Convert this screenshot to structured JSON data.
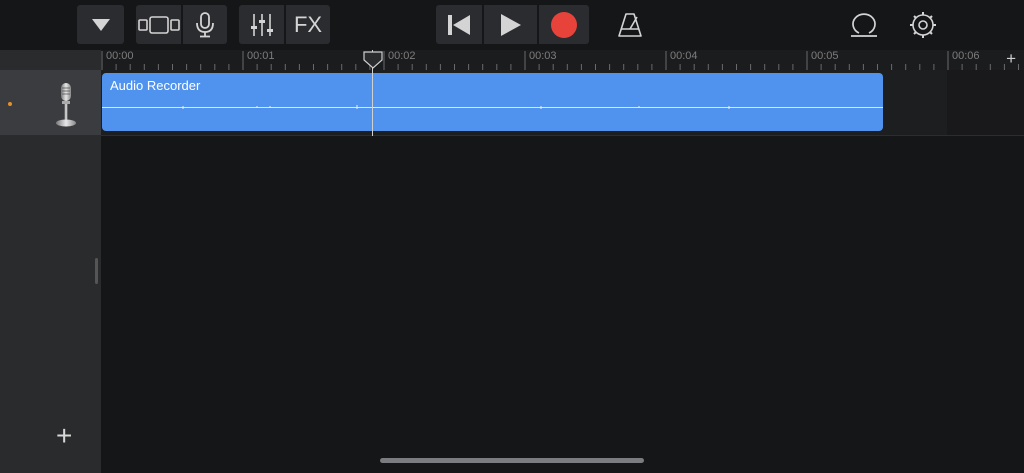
{
  "toolbar": {
    "fx_label": "FX",
    "record_color": "#e8433a",
    "region_color": "#5093ef",
    "icons": [
      "dropdown-triangle-icon",
      "track-view-icon",
      "microphone-icon",
      "mixer-sliders-icon",
      "rewind-to-start-icon",
      "play-icon",
      "record-icon",
      "metronome-icon",
      "loop-icon",
      "settings-gear-icon"
    ]
  },
  "ruler": {
    "ticks": [
      "00:00",
      "00:01",
      "00:02",
      "00:03",
      "00:04",
      "00:05",
      "00:06"
    ],
    "add_section_label": "+"
  },
  "tracks": [
    {
      "icon": "microphone-stand-icon",
      "region_label": "Audio Recorder",
      "selected": true
    }
  ],
  "sidebar": {
    "add_track_label": "+"
  }
}
